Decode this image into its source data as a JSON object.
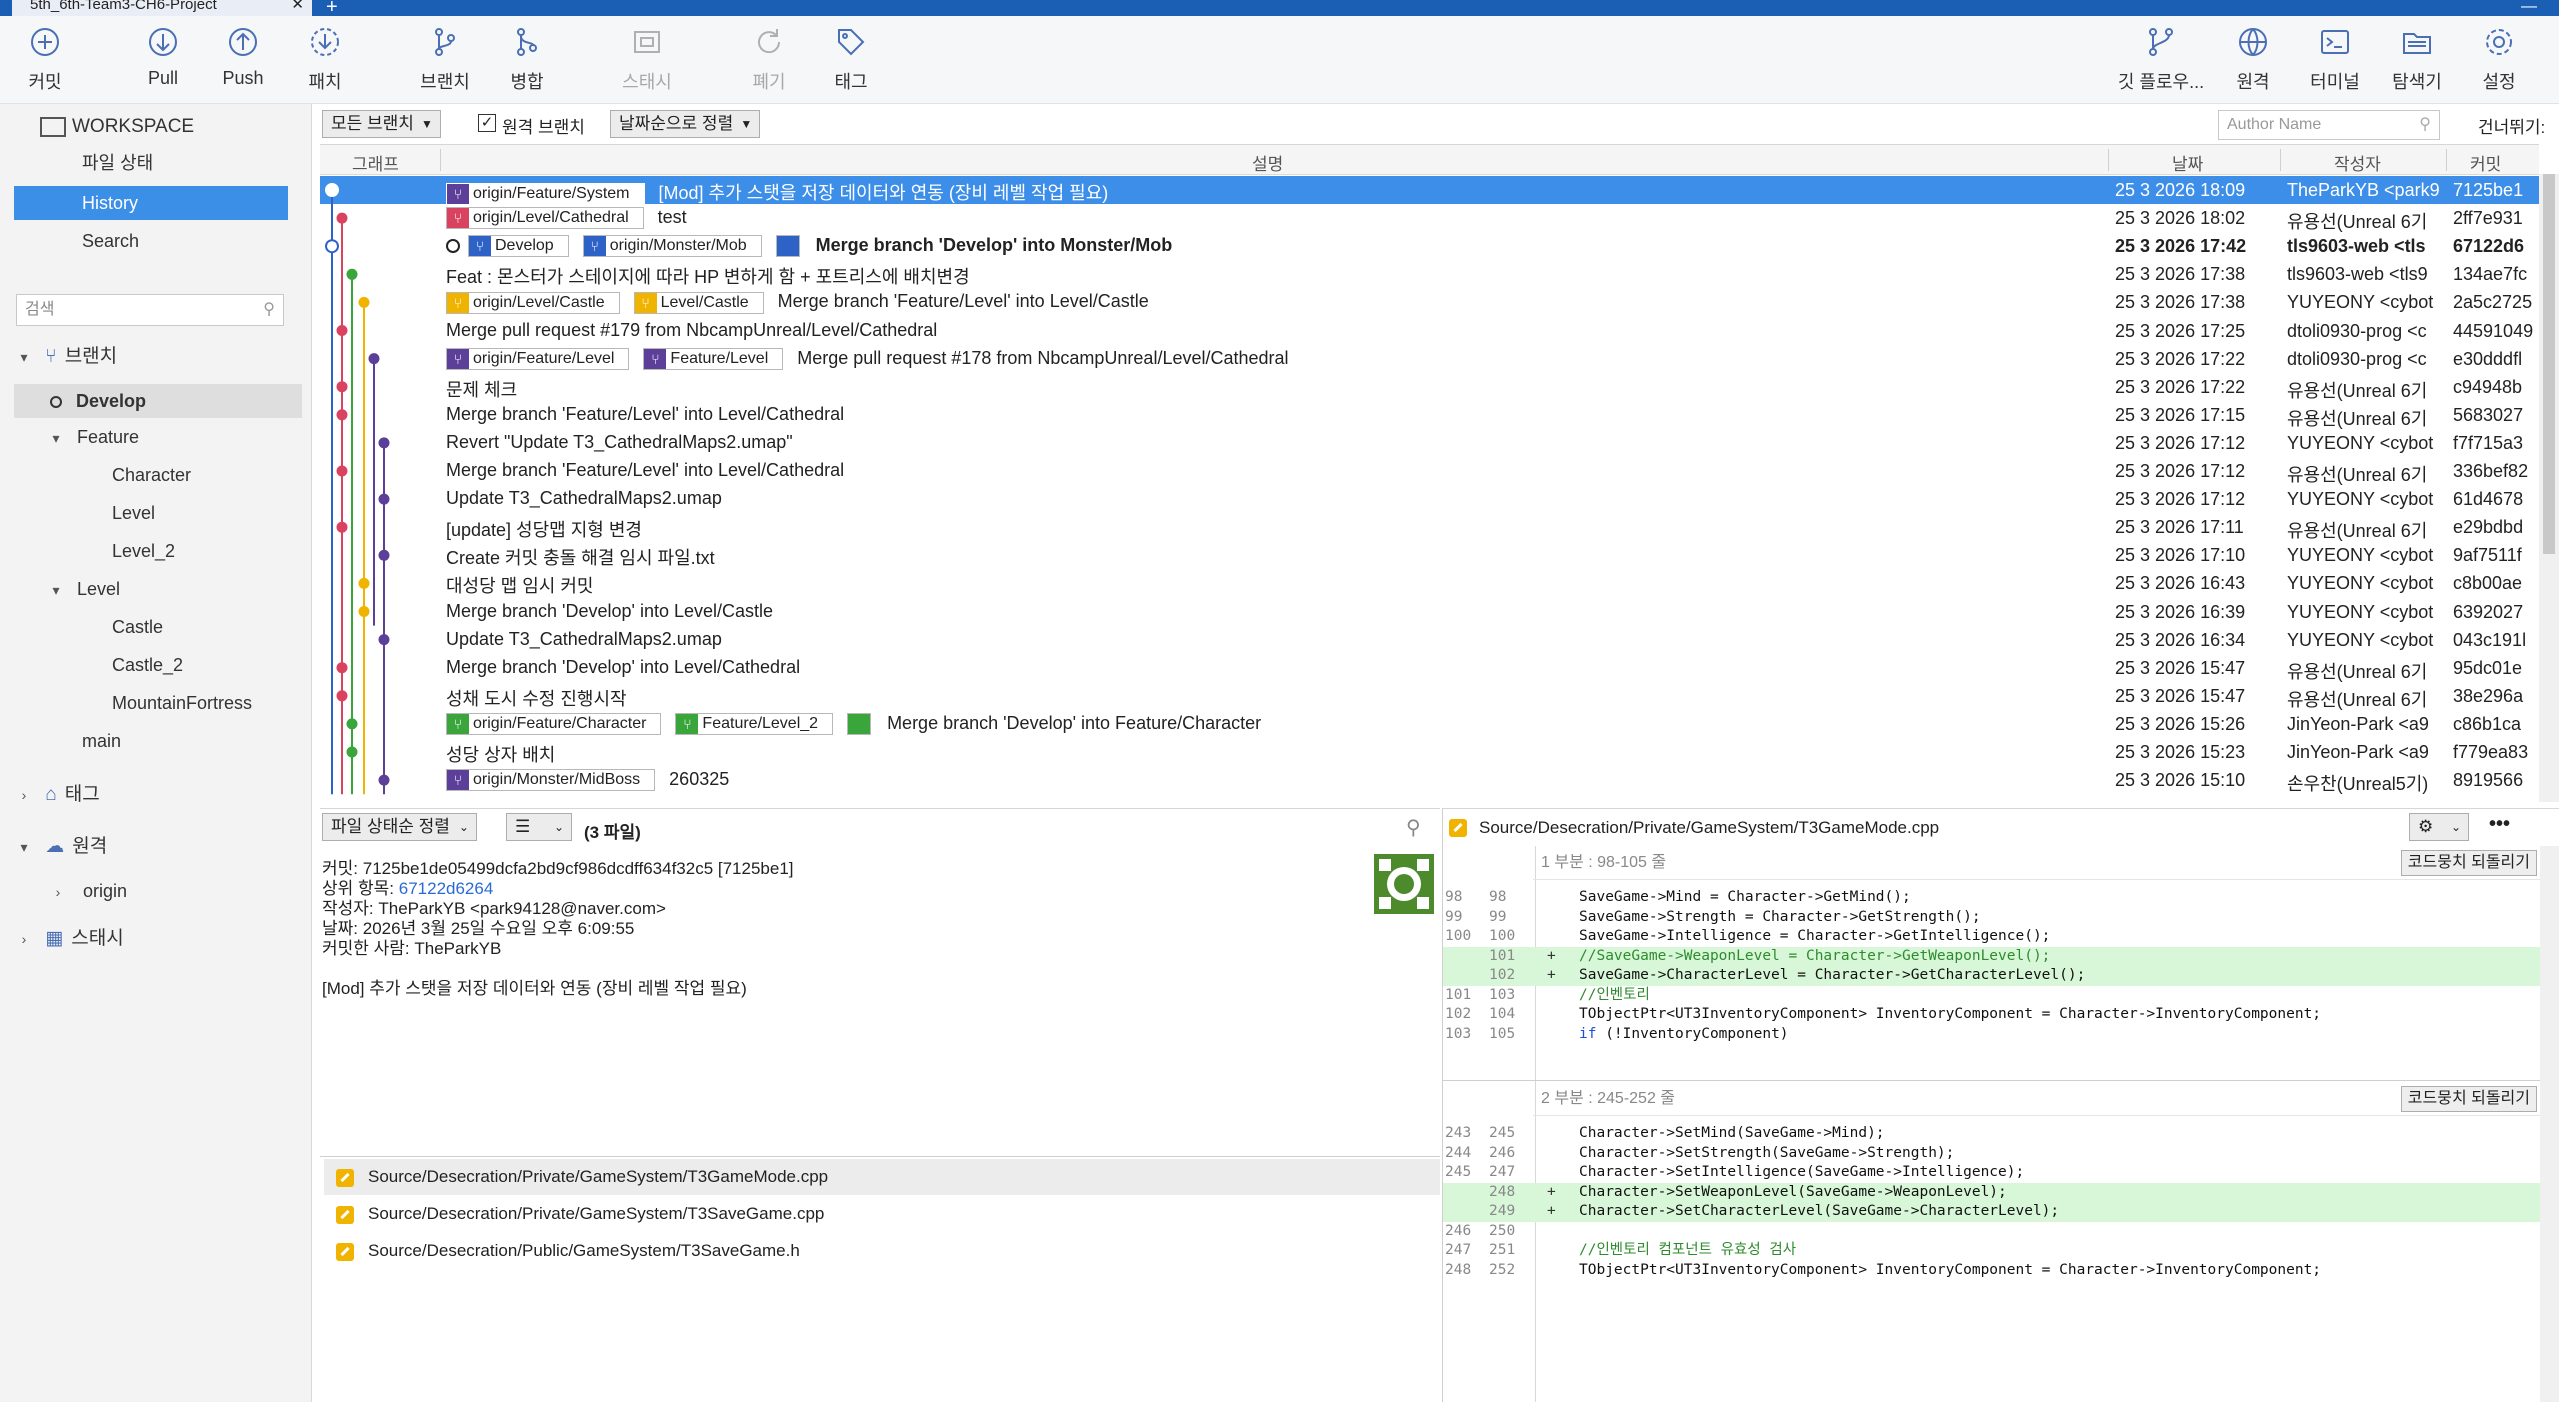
{
  "window": {
    "tab_title": "5th_6th-Team3-CH6-Project",
    "close_glyph": "✕",
    "new_tab_glyph": "+",
    "minimize_glyph": "—"
  },
  "toolbar": {
    "left": [
      {
        "id": "commit",
        "label": "커밋",
        "icon": "plus-circle-icon",
        "disabled": false
      },
      {
        "id": "pull",
        "label": "Pull",
        "icon": "arrow-down-circle-icon",
        "disabled": false
      },
      {
        "id": "push",
        "label": "Push",
        "icon": "arrow-up-circle-icon",
        "disabled": false
      },
      {
        "id": "fetch",
        "label": "패치",
        "icon": "fetch-icon",
        "disabled": false
      },
      {
        "id": "branch",
        "label": "브랜치",
        "icon": "branch-icon",
        "disabled": false
      },
      {
        "id": "merge",
        "label": "병합",
        "icon": "merge-icon",
        "disabled": false
      },
      {
        "id": "stash",
        "label": "스태시",
        "icon": "stash-icon",
        "disabled": true
      },
      {
        "id": "discard",
        "label": "폐기",
        "icon": "discard-icon",
        "disabled": true
      },
      {
        "id": "tag",
        "label": "태그",
        "icon": "tag-icon",
        "disabled": false
      }
    ],
    "right": [
      {
        "id": "gitflow",
        "label": "깃 플로우...",
        "icon": "git-flow-icon"
      },
      {
        "id": "remote",
        "label": "원격",
        "icon": "globe-icon"
      },
      {
        "id": "terminal",
        "label": "터미널",
        "icon": "terminal-icon"
      },
      {
        "id": "explorer",
        "label": "탐색기",
        "icon": "folder-icon"
      },
      {
        "id": "settings",
        "label": "설정",
        "icon": "gear-icon"
      }
    ]
  },
  "sidebar": {
    "workspace": "WORKSPACE",
    "file_status": "파일 상태",
    "history": "History",
    "search": "Search",
    "filter_placeholder": "검색",
    "branches_label": "브랜치",
    "branches": {
      "develop": "Develop",
      "feature": "Feature",
      "feature_children": [
        "Character",
        "Level",
        "Level_2"
      ],
      "level": "Level",
      "level_children": [
        "Castle",
        "Castle_2",
        "MountainFortress"
      ],
      "main": "main"
    },
    "tags_label": "태그",
    "remotes_label": "원격",
    "remotes": [
      "origin"
    ],
    "stash_label": "스태시"
  },
  "filterbar": {
    "branch_filter": "모든 브랜치",
    "remote_branch_label": "원격 브랜치",
    "remote_branch_checked": true,
    "sort": "날짜순으로 정렬",
    "author_placeholder": "Author Name",
    "skip_label": "건너뛰기:"
  },
  "commit_table": {
    "headers": {
      "graph": "그래프",
      "description": "설명",
      "date": "날짜",
      "author": "작성자",
      "commit": "커밋"
    },
    "rows": [
      {
        "refs": [
          {
            "name": "origin/Feature/System",
            "color": "#5b3f98"
          }
        ],
        "desc": "[Mod] 추가 스탯을 저장 데이터와 연동 (장비 레벨 작업 필요)",
        "date": "25 3 2026 18:09",
        "author": "TheParkYB <park9",
        "hash": "7125be1",
        "selected": true
      },
      {
        "refs": [
          {
            "name": "origin/Level/Cathedral",
            "color": "#d9435f"
          }
        ],
        "desc": "test",
        "date": "25 3 2026 18:02",
        "author": "유용선(Unreal 6기",
        "hash": "2ff7e931"
      },
      {
        "head": true,
        "refs": [
          {
            "name": "Develop",
            "color": "#2f62c7"
          },
          {
            "name": "origin/Monster/Mob",
            "color": "#2f62c7"
          },
          {
            "name": "",
            "color": "#2f62c7"
          }
        ],
        "desc": "Merge branch 'Develop' into Monster/Mob",
        "date": "25 3 2026 17:42",
        "author": "tls9603-web <tls",
        "hash": "67122d6",
        "bold": true
      },
      {
        "refs": [],
        "desc": "Feat : 몬스터가 스테이지에 따라 HP 변하게 함 + 포트리스에 배치변경",
        "date": "25 3 2026 17:38",
        "author": "tls9603-web <tls9",
        "hash": "134ae7fc"
      },
      {
        "refs": [
          {
            "name": "origin/Level/Castle",
            "color": "#f0b400"
          },
          {
            "name": "Level/Castle",
            "color": "#f0b400"
          }
        ],
        "desc": "Merge branch 'Feature/Level' into Level/Castle",
        "date": "25 3 2026 17:38",
        "author": "YUYEONY <cybot",
        "hash": "2a5c2725"
      },
      {
        "refs": [],
        "desc": "Merge pull request #179 from NbcampUnreal/Level/Cathedral",
        "date": "25 3 2026 17:25",
        "author": "dtoli0930-prog <c",
        "hash": "44591049"
      },
      {
        "refs": [
          {
            "name": "origin/Feature/Level",
            "color": "#5b3f98"
          },
          {
            "name": "Feature/Level",
            "color": "#5b3f98"
          }
        ],
        "desc": "Merge pull request #178 from NbcampUnreal/Level/Cathedral",
        "date": "25 3 2026 17:22",
        "author": "dtoli0930-prog <c",
        "hash": "e30dddfl"
      },
      {
        "refs": [],
        "desc": "문제 체크",
        "date": "25 3 2026 17:22",
        "author": "유용선(Unreal 6기",
        "hash": "c94948b"
      },
      {
        "refs": [],
        "desc": "Merge branch 'Feature/Level' into Level/Cathedral",
        "date": "25 3 2026 17:15",
        "author": "유용선(Unreal 6기",
        "hash": "5683027"
      },
      {
        "refs": [],
        "desc": "Revert \"Update T3_CathedralMaps2.umap\"",
        "date": "25 3 2026 17:12",
        "author": "YUYEONY <cybot",
        "hash": "f7f715a3"
      },
      {
        "refs": [],
        "desc": "Merge branch 'Feature/Level' into Level/Cathedral",
        "date": "25 3 2026 17:12",
        "author": "유용선(Unreal 6기",
        "hash": "336bef82"
      },
      {
        "refs": [],
        "desc": "Update T3_CathedralMaps2.umap",
        "date": "25 3 2026 17:12",
        "author": "YUYEONY <cybot",
        "hash": "61d4678"
      },
      {
        "refs": [],
        "desc": "[update] 성당맵 지형 변경",
        "date": "25 3 2026 17:11",
        "author": "유용선(Unreal 6기",
        "hash": "e29bdbd"
      },
      {
        "refs": [],
        "desc": "Create 커밋 충돌 해결 임시 파일.txt",
        "date": "25 3 2026 17:10",
        "author": "YUYEONY <cybot",
        "hash": "9af7511f"
      },
      {
        "refs": [],
        "desc": "대성당 맵 임시 커밋",
        "date": "25 3 2026 16:43",
        "author": "YUYEONY <cybot",
        "hash": "c8b00ae"
      },
      {
        "refs": [],
        "desc": "Merge branch 'Develop' into Level/Castle",
        "date": "25 3 2026 16:39",
        "author": "YUYEONY <cybot",
        "hash": "6392027"
      },
      {
        "refs": [],
        "desc": "Update T3_CathedralMaps2.umap",
        "date": "25 3 2026 16:34",
        "author": "YUYEONY <cybot",
        "hash": "043c191l"
      },
      {
        "refs": [],
        "desc": "Merge branch 'Develop' into Level/Cathedral",
        "date": "25 3 2026 15:47",
        "author": "유용선(Unreal 6기",
        "hash": "95dc01e"
      },
      {
        "refs": [],
        "desc": "성채 도시 수정 진행시작",
        "date": "25 3 2026 15:47",
        "author": "유용선(Unreal 6기",
        "hash": "38e296a"
      },
      {
        "refs": [
          {
            "name": "origin/Feature/Character",
            "color": "#3aa53a"
          },
          {
            "name": "Feature/Level_2",
            "color": "#3aa53a"
          },
          {
            "name": "",
            "color": "#3aa53a"
          }
        ],
        "desc": "Merge branch 'Develop' into Feature/Character",
        "date": "25 3 2026 15:26",
        "author": "JinYeon-Park <a9",
        "hash": "c86b1ca"
      },
      {
        "refs": [],
        "desc": "성당 상자 배치",
        "date": "25 3 2026 15:23",
        "author": "JinYeon-Park <a9",
        "hash": "f779ea83"
      },
      {
        "refs": [
          {
            "name": "origin/Monster/MidBoss",
            "color": "#5b3f98"
          }
        ],
        "desc": "260325",
        "date": "25 3 2026 15:10",
        "author": "손우찬(Unreal5기)",
        "hash": "8919566"
      }
    ]
  },
  "details": {
    "sort_label": "파일 상태순 정렬",
    "list_view_icon": "list-icon",
    "file_count": "(3 파일)",
    "commit_label": "커밋:",
    "commit_value": "7125be1de05499dcfa2bd9cf986dcdff634f32c5 [7125be1]",
    "parent_label": "상위 항목:",
    "parent_value": "67122d6264",
    "author_label": "작성자:",
    "author_value": "TheParkYB <park94128@naver.com>",
    "date_label": "날짜:",
    "date_value": "2026년 3월 25일 수요일 오후 6:09:55",
    "committer_label": "커밋한 사람:",
    "committer_value": "TheParkYB",
    "message": "[Mod] 추가 스탯을 저장 데이터와 연동 (장비 레벨 작업 필요)"
  },
  "files": [
    "Source/Desecration/Private/GameSystem/T3GameMode.cpp",
    "Source/Desecration/Private/GameSystem/T3SaveGame.cpp",
    "Source/Desecration/Public/GameSystem/T3SaveGame.h"
  ],
  "diff": {
    "file": "Source/Desecration/Private/GameSystem/T3GameMode.cpp",
    "revert_label": "코드뭉치 되돌리기",
    "hunks": [
      {
        "title": "1 부분 : 98-105 줄",
        "lines": [
          {
            "o": "98",
            "n": "98",
            "m": "",
            "t": "SaveGame->Mind = Character->GetMind();"
          },
          {
            "o": "99",
            "n": "99",
            "m": "",
            "t": "SaveGame->Strength = Character->GetStrength();"
          },
          {
            "o": "100",
            "n": "100",
            "m": "",
            "t": "SaveGame->Intelligence = Character->GetIntelligence();"
          },
          {
            "o": "",
            "n": "101",
            "m": "+",
            "t": "//SaveGame->WeaponLevel = Character->GetWeaponLevel();",
            "add": true,
            "cls": "cm"
          },
          {
            "o": "",
            "n": "102",
            "m": "+",
            "t": "SaveGame->CharacterLevel = Character->GetCharacterLevel();",
            "add": true
          },
          {
            "o": "101",
            "n": "103",
            "m": "",
            "t": "//인벤토리",
            "cls": "cm"
          },
          {
            "o": "102",
            "n": "104",
            "m": "",
            "t": "TObjectPtr<UT3InventoryComponent> InventoryComponent = Character->InventoryComponent;"
          },
          {
            "o": "103",
            "n": "105",
            "m": "",
            "t": "if (!InventoryComponent)",
            "kw": true
          }
        ]
      },
      {
        "title": "2 부분 : 245-252 줄",
        "lines": [
          {
            "o": "243",
            "n": "245",
            "m": "",
            "t": "Character->SetMind(SaveGame->Mind);"
          },
          {
            "o": "244",
            "n": "246",
            "m": "",
            "t": "Character->SetStrength(SaveGame->Strength);"
          },
          {
            "o": "245",
            "n": "247",
            "m": "",
            "t": "Character->SetIntelligence(SaveGame->Intelligence);"
          },
          {
            "o": "",
            "n": "248",
            "m": "+",
            "t": "Character->SetWeaponLevel(SaveGame->WeaponLevel);",
            "add": true
          },
          {
            "o": "",
            "n": "249",
            "m": "+",
            "t": "Character->SetCharacterLevel(SaveGame->CharacterLevel);",
            "add": true
          },
          {
            "o": "246",
            "n": "250",
            "m": "",
            "t": ""
          },
          {
            "o": "247",
            "n": "251",
            "m": "",
            "t": "//인벤토리 컴포넌트 유효성 검사",
            "cls": "cm"
          },
          {
            "o": "248",
            "n": "252",
            "m": "",
            "t": "TObjectPtr<UT3InventoryComponent> InventoryComponent = Character->InventoryComponent;"
          }
        ]
      }
    ]
  },
  "colors": {
    "accent": "#3d8ee8",
    "title_bar": "#1a5fb4",
    "add_bg": "#d8f7d8",
    "modified_file": "#f0b400"
  }
}
